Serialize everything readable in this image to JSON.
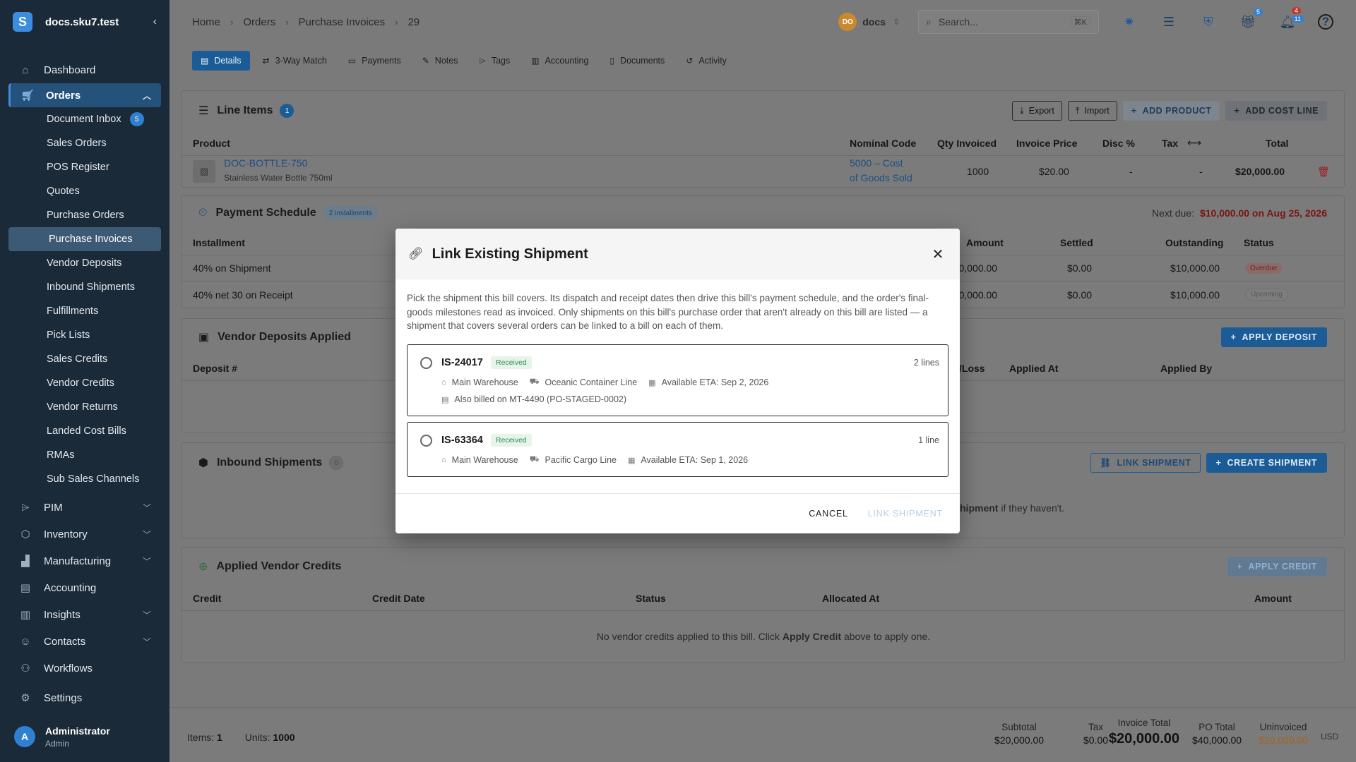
{
  "sidebar": {
    "logo": "S",
    "title": "docs.sku7.test",
    "collapse_icon": "‹",
    "top_items": [
      {
        "label": "Dashboard",
        "icon": "home-icon"
      }
    ],
    "orders": {
      "label": "Orders",
      "icon": "cart-icon"
    },
    "sub_items": [
      {
        "label": "Document Inbox",
        "badge": "5"
      },
      {
        "label": "Sales Orders"
      },
      {
        "label": "POS Register"
      },
      {
        "label": "Quotes"
      },
      {
        "label": "Purchase Orders"
      },
      {
        "label": "Purchase Invoices",
        "active": true
      },
      {
        "label": "Vendor Deposits"
      },
      {
        "label": "Inbound Shipments"
      },
      {
        "label": "Fulfillments"
      },
      {
        "label": "Pick Lists"
      },
      {
        "label": "Sales Credits"
      },
      {
        "label": "Vendor Credits"
      },
      {
        "label": "Vendor Returns"
      },
      {
        "label": "Landed Cost Bills"
      },
      {
        "label": "RMAs"
      },
      {
        "label": "Sub Sales Channels"
      }
    ],
    "bottom_items": [
      {
        "label": "PIM",
        "icon": "tag-icon",
        "chevron": true
      },
      {
        "label": "Inventory",
        "icon": "box-icon",
        "chevron": true
      },
      {
        "label": "Manufacturing",
        "icon": "factory-icon",
        "chevron": true
      },
      {
        "label": "Accounting",
        "icon": "ledger-icon",
        "chevron": false
      },
      {
        "label": "Insights",
        "icon": "chart-icon",
        "chevron": true
      },
      {
        "label": "Contacts",
        "icon": "people-icon",
        "chevron": true
      },
      {
        "label": "Workflows",
        "icon": "workflow-icon",
        "chevron": false
      },
      {
        "label": "Settings",
        "icon": "gear-icon",
        "chevron": false
      }
    ],
    "user": {
      "initial": "A",
      "name": "Administrator",
      "role": "Admin"
    }
  },
  "topbar": {
    "breadcrumbs": [
      "Home",
      "Orders",
      "Purchase Invoices",
      "29"
    ],
    "workspace_initials": "DO",
    "workspace_name": "docs",
    "search_placeholder": "Search...",
    "search_shortcut": "⌘K",
    "badges": {
      "gift": "5",
      "bell_red": "4",
      "bell_blue": "11"
    }
  },
  "tabs": [
    "Details",
    "3-Way Match",
    "Payments",
    "Notes",
    "Tags",
    "Accounting",
    "Documents",
    "Activity"
  ],
  "line_items": {
    "title": "Line Items",
    "count": "1",
    "buttons": {
      "export": "Export",
      "import": "Import",
      "add_product": "ADD PRODUCT",
      "add_cost_line": "ADD COST LINE"
    },
    "columns": {
      "product": "Product",
      "nominal": "Nominal Code",
      "qty": "Qty Invoiced",
      "price": "Invoice Price",
      "disc": "Disc %",
      "tax": "Tax",
      "total": "Total"
    },
    "row": {
      "sku": "DOC-BOTTLE-750",
      "name": "Stainless Water Bottle 750ml",
      "nominal_1": "5000 – Cost",
      "nominal_2": "of Goods Sold",
      "qty": "1000",
      "price": "$20.00",
      "disc": "-",
      "tax": "-",
      "total": "$20,000.00"
    }
  },
  "payment_schedule": {
    "title": "Payment Schedule",
    "pill": "2 installments",
    "next_due_label": "Next due:",
    "next_due_value": "$10,000.00 on Aug 25, 2026",
    "columns": {
      "installment": "Installment",
      "amount": "Amount",
      "settled": "Settled",
      "outstanding": "Outstanding",
      "status": "Status"
    },
    "rows": [
      {
        "installment": "40% on Shipment",
        "amount": "$10,000.00",
        "settled": "$0.00",
        "outstanding": "$10,000.00",
        "status": "Overdue"
      },
      {
        "installment": "40% net 30 on Receipt",
        "amount": "$10,000.00",
        "settled": "$0.00",
        "outstanding": "$10,000.00",
        "status": "Upcoming"
      }
    ]
  },
  "vendor_deposits": {
    "title": "Vendor Deposits Applied",
    "button": "APPLY DEPOSIT",
    "columns": {
      "deposit": "Deposit #",
      "gainloss": "/Loss",
      "applied_at": "Applied At",
      "applied_by": "Applied By"
    }
  },
  "inbound_shipments": {
    "title": "Inbound Shipments",
    "count": "0",
    "link_button": "LINK SHIPMENT",
    "create_button": "CREATE SHIPMENT",
    "empty_bold": "hipment",
    "empty_rest": " if they haven't."
  },
  "vendor_credits": {
    "title": "Applied Vendor Credits",
    "button": "APPLY CREDIT",
    "columns": {
      "credit": "Credit",
      "credit_date": "Credit Date",
      "status": "Status",
      "allocated_at": "Allocated At",
      "amount": "Amount"
    },
    "empty_pre": "No vendor credits applied to this bill. Click ",
    "empty_bold": "Apply Credit",
    "empty_post": " above to apply one."
  },
  "footer": {
    "items_label": "Items:",
    "items_value": "1",
    "units_label": "Units:",
    "units_value": "1000",
    "subtotal_label": "Subtotal",
    "subtotal_value": "$20,000.00",
    "tax_label": "Tax",
    "tax_value": "$0.00",
    "invoice_total_label": "Invoice Total",
    "invoice_total_value": "$20,000.00",
    "po_total_label": "PO Total",
    "po_total_value": "$40,000.00",
    "uninvoiced_label": "Uninvoiced",
    "uninvoiced_value": "$20,000.00",
    "currency": "USD"
  },
  "modal": {
    "title": "Link Existing Shipment",
    "description": "Pick the shipment this bill covers. Its dispatch and receipt dates then drive this bill's payment schedule, and the order's final-goods milestones read as invoiced. Only shipments on this bill's purchase order that aren't already on this bill are listed — a shipment that covers several orders can be linked to a bill on each of them.",
    "options": [
      {
        "id": "IS-24017",
        "status": "Received",
        "lines": "2 lines",
        "warehouse": "Main Warehouse",
        "carrier": "Oceanic Container Line",
        "eta": "Available ETA: Sep 2, 2026",
        "also_billed": "Also billed on MT-4490 (PO-STAGED-0002)"
      },
      {
        "id": "IS-63364",
        "status": "Received",
        "lines": "1 line",
        "warehouse": "Main Warehouse",
        "carrier": "Pacific Cargo Line",
        "eta": "Available ETA: Sep 1, 2026"
      }
    ],
    "cancel": "CANCEL",
    "confirm": "LINK SHIPMENT"
  },
  "colors": {
    "accent": "#1c5c96",
    "sidebar": "#1b2a38",
    "overdue": "#b00020",
    "uninvoiced": "#e08a1e"
  }
}
